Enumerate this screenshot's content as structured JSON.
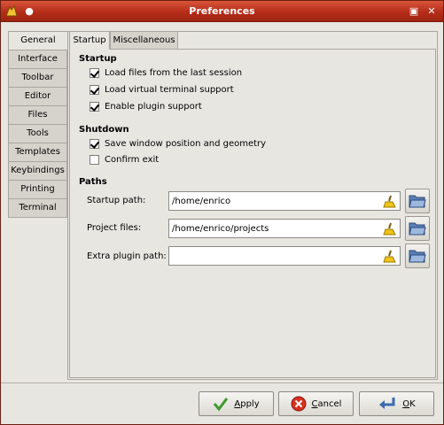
{
  "window": {
    "title": "Preferences"
  },
  "left_tabs": [
    "General",
    "Interface",
    "Toolbar",
    "Editor",
    "Files",
    "Tools",
    "Templates",
    "Keybindings",
    "Printing",
    "Terminal"
  ],
  "top_tabs": [
    "Startup",
    "Miscellaneous"
  ],
  "startup": {
    "heading": "Startup",
    "options": [
      {
        "label": "Load files from the last session",
        "checked": true
      },
      {
        "label": "Load virtual terminal support",
        "checked": true
      },
      {
        "label": "Enable plugin support",
        "checked": true
      }
    ]
  },
  "shutdown": {
    "heading": "Shutdown",
    "options": [
      {
        "label": "Save window position and geometry",
        "checked": true
      },
      {
        "label": "Confirm exit",
        "checked": false
      }
    ]
  },
  "paths": {
    "heading": "Paths",
    "startup_label": "Startup path:",
    "startup_value": "/home/enrico",
    "project_label": "Project files:",
    "project_value": "/home/enrico/projects",
    "plugin_label": "Extra plugin path:",
    "plugin_value": ""
  },
  "buttons": {
    "apply_first": "A",
    "apply_rest": "pply",
    "cancel_first": "C",
    "cancel_rest": "ancel",
    "ok_first": "O",
    "ok_rest": "K"
  },
  "colors": {
    "titlebar": "#b52d18",
    "background": "#e8e6e1"
  }
}
